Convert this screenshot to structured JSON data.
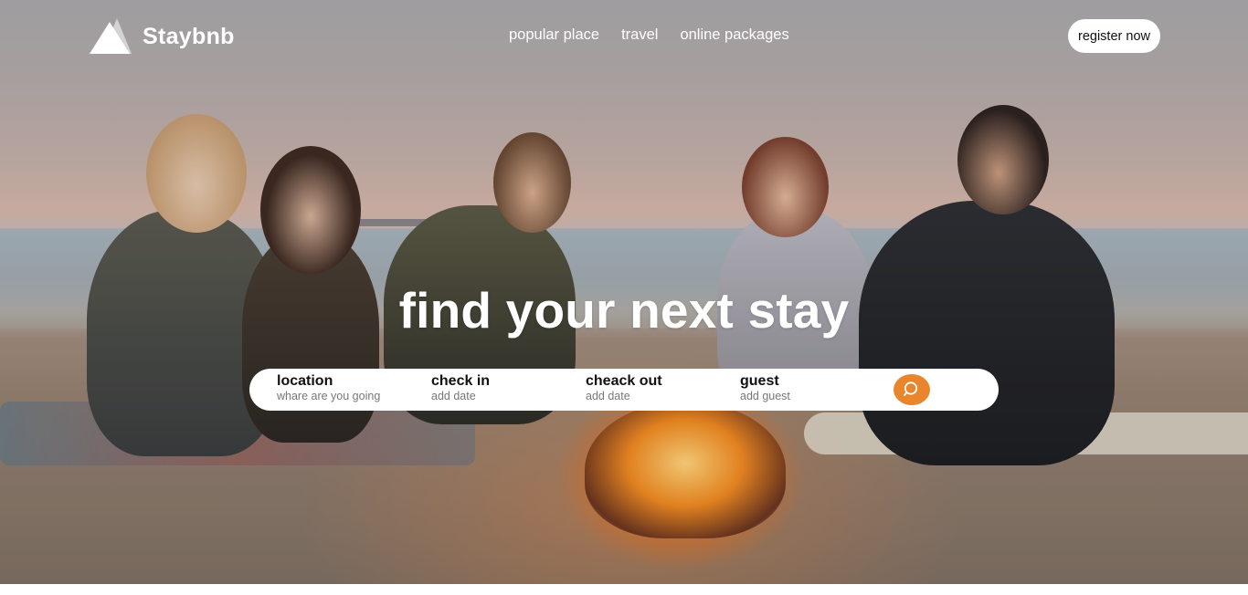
{
  "brand": {
    "name": "Staybnb"
  },
  "nav": {
    "items": [
      {
        "label": "popular place"
      },
      {
        "label": "travel"
      },
      {
        "label": "online packages"
      }
    ]
  },
  "header": {
    "register_label": "register now"
  },
  "hero": {
    "headline": "find your next stay"
  },
  "search": {
    "fields": [
      {
        "label": "location",
        "hint": "whare are you going"
      },
      {
        "label": "check in",
        "hint": "add date"
      },
      {
        "label": "cheack out",
        "hint": "add date"
      },
      {
        "label": "guest",
        "hint": "add guest"
      }
    ],
    "button_icon": "search-icon",
    "accent_color": "#e9862d"
  }
}
